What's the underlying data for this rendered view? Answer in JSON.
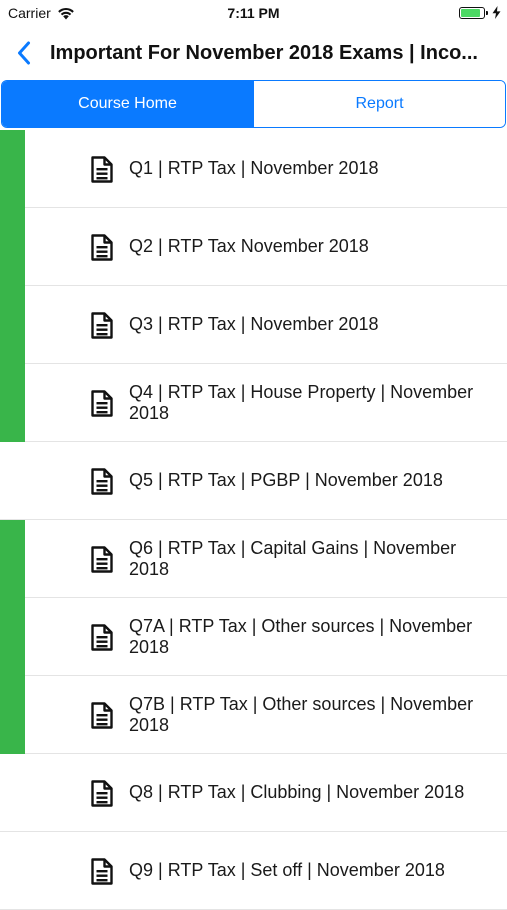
{
  "status": {
    "carrier": "Carrier",
    "time": "7:11 PM",
    "battery_level": 0.9,
    "battery_color": "#4cd964"
  },
  "nav": {
    "title": "Important For November 2018 Exams | Inco...",
    "back_icon": "chevron-left-icon"
  },
  "tabs": [
    {
      "label": "Course Home",
      "active": true
    },
    {
      "label": "Report",
      "active": false
    }
  ],
  "accent_color": "#0a7aff",
  "completed_color": "#39b54a",
  "items": [
    {
      "title": "Q1 | RTP Tax | November 2018",
      "completed": true,
      "icon": "document-icon"
    },
    {
      "title": "Q2 | RTP Tax November 2018",
      "completed": true,
      "icon": "document-icon"
    },
    {
      "title": "Q3 | RTP Tax | November 2018",
      "completed": true,
      "icon": "document-icon"
    },
    {
      "title": "Q4 | RTP Tax | House Property | November 2018",
      "completed": true,
      "icon": "document-icon"
    },
    {
      "title": "Q5 | RTP Tax | PGBP | November 2018",
      "completed": false,
      "icon": "document-icon"
    },
    {
      "title": "Q6 | RTP Tax | Capital Gains | November 2018",
      "completed": true,
      "icon": "document-icon"
    },
    {
      "title": "Q7A | RTP Tax | Other sources | November 2018",
      "completed": true,
      "icon": "document-icon"
    },
    {
      "title": "Q7B | RTP Tax | Other sources | November 2018",
      "completed": true,
      "icon": "document-icon"
    },
    {
      "title": "Q8 | RTP Tax | Clubbing | November 2018",
      "completed": false,
      "icon": "document-icon"
    },
    {
      "title": "Q9 | RTP Tax | Set off | November 2018",
      "completed": false,
      "icon": "document-icon"
    }
  ]
}
